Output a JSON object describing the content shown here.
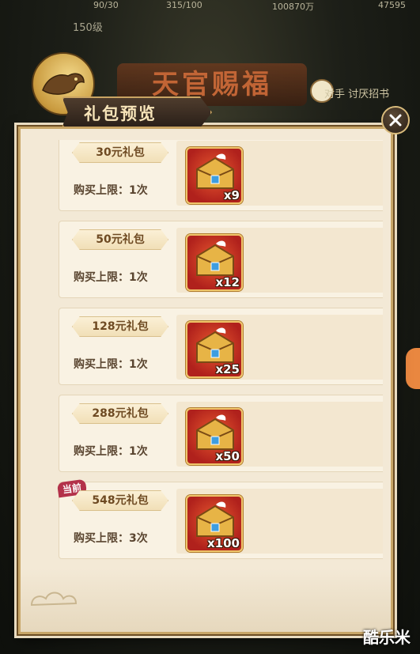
{
  "hud": {
    "stat1": "90/30",
    "stat2": "315/100",
    "stat3": "100870万",
    "stat4": "47595",
    "level": "150级",
    "banner": "天官赐福",
    "right_text": "对手 讨厌招书"
  },
  "dialog": {
    "title": "礼包预览",
    "close_icon": "close-icon"
  },
  "packages": [
    {
      "name": "30元礼包",
      "limit": "购买上限：1次",
      "qty": "x9"
    },
    {
      "name": "50元礼包",
      "limit": "购买上限：1次",
      "qty": "x12"
    },
    {
      "name": "128元礼包",
      "limit": "购买上限：1次",
      "qty": "x25"
    },
    {
      "name": "288元礼包",
      "limit": "购买上限：1次",
      "qty": "x50"
    },
    {
      "name": "548元礼包",
      "limit": "购买上限：3次",
      "qty": "x100",
      "badge": "当前"
    }
  ],
  "watermark": "酷乐米",
  "colors": {
    "accent": "#c9a463",
    "item_bg": "#b0211c",
    "badge": "#b3314a"
  }
}
